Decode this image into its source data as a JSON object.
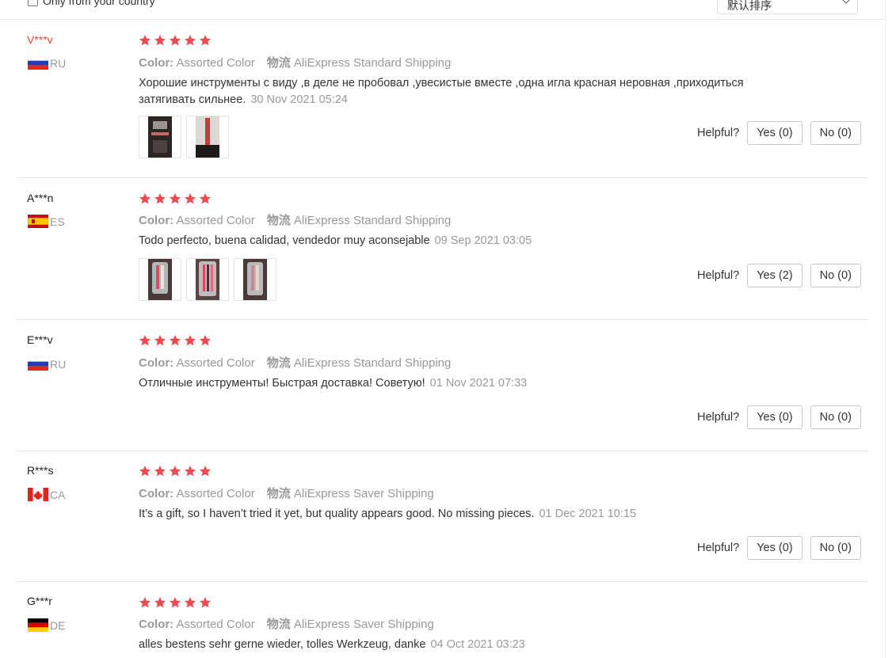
{
  "filter": {
    "only_country_label": "Only from your country"
  },
  "sort": {
    "selected": "默认排序"
  },
  "labels": {
    "color": "Color:",
    "shipping": "物流",
    "helpful": "Helpful?"
  },
  "reviews": [
    {
      "user": "V***v",
      "country": "RU",
      "stars": 5,
      "color_value": "Assorted Color",
      "shipping_value": "AliExpress Standard Shipping",
      "text": "Хорошие инструменты с виду ,в деле не пробовал ,увесистые вместе ,одна игла красная неровная ,приходиться затягивать сильнее.",
      "date": "30 Nov 2021 05:24",
      "yes": "Yes (0)",
      "no": "No (0)"
    },
    {
      "user": "A***n",
      "country": "ES",
      "stars": 5,
      "color_value": "Assorted Color",
      "shipping_value": "AliExpress Standard Shipping",
      "text": "Todo perfecto, buena calidad, vendedor muy aconsejable",
      "date": "09 Sep 2021 03:05",
      "yes": "Yes (2)",
      "no": "No (0)"
    },
    {
      "user": "E***v",
      "country": "RU",
      "stars": 5,
      "color_value": "Assorted Color",
      "shipping_value": "AliExpress Standard Shipping",
      "text": "Отличные инструменты! Быстрая доставка! Советую!",
      "date": "01 Nov 2021 07:33",
      "yes": "Yes (0)",
      "no": "No (0)"
    },
    {
      "user": "R***s",
      "country": "CA",
      "stars": 5,
      "color_value": "Assorted Color",
      "shipping_value": "AliExpress Saver Shipping",
      "text": "It’s a gift, so I haven’t tried it yet, but quality appears good. No missing pieces.",
      "date": "01 Dec 2021 10:15",
      "yes": "Yes (0)",
      "no": "No (0)"
    },
    {
      "user": "G***r",
      "country": "DE",
      "stars": 5,
      "color_value": "Assorted Color",
      "shipping_value": "AliExpress Saver Shipping",
      "text": "alles bestens sehr gerne wieder, tolles Werkzeug, danke",
      "date": "04 Oct 2021 03:23"
    }
  ],
  "colors": {
    "star": "#f2484f",
    "accent_red": "#f44336",
    "muted": "#999999"
  },
  "icons": {
    "star": "star-icon",
    "dropdown": "chevron-down-icon"
  }
}
